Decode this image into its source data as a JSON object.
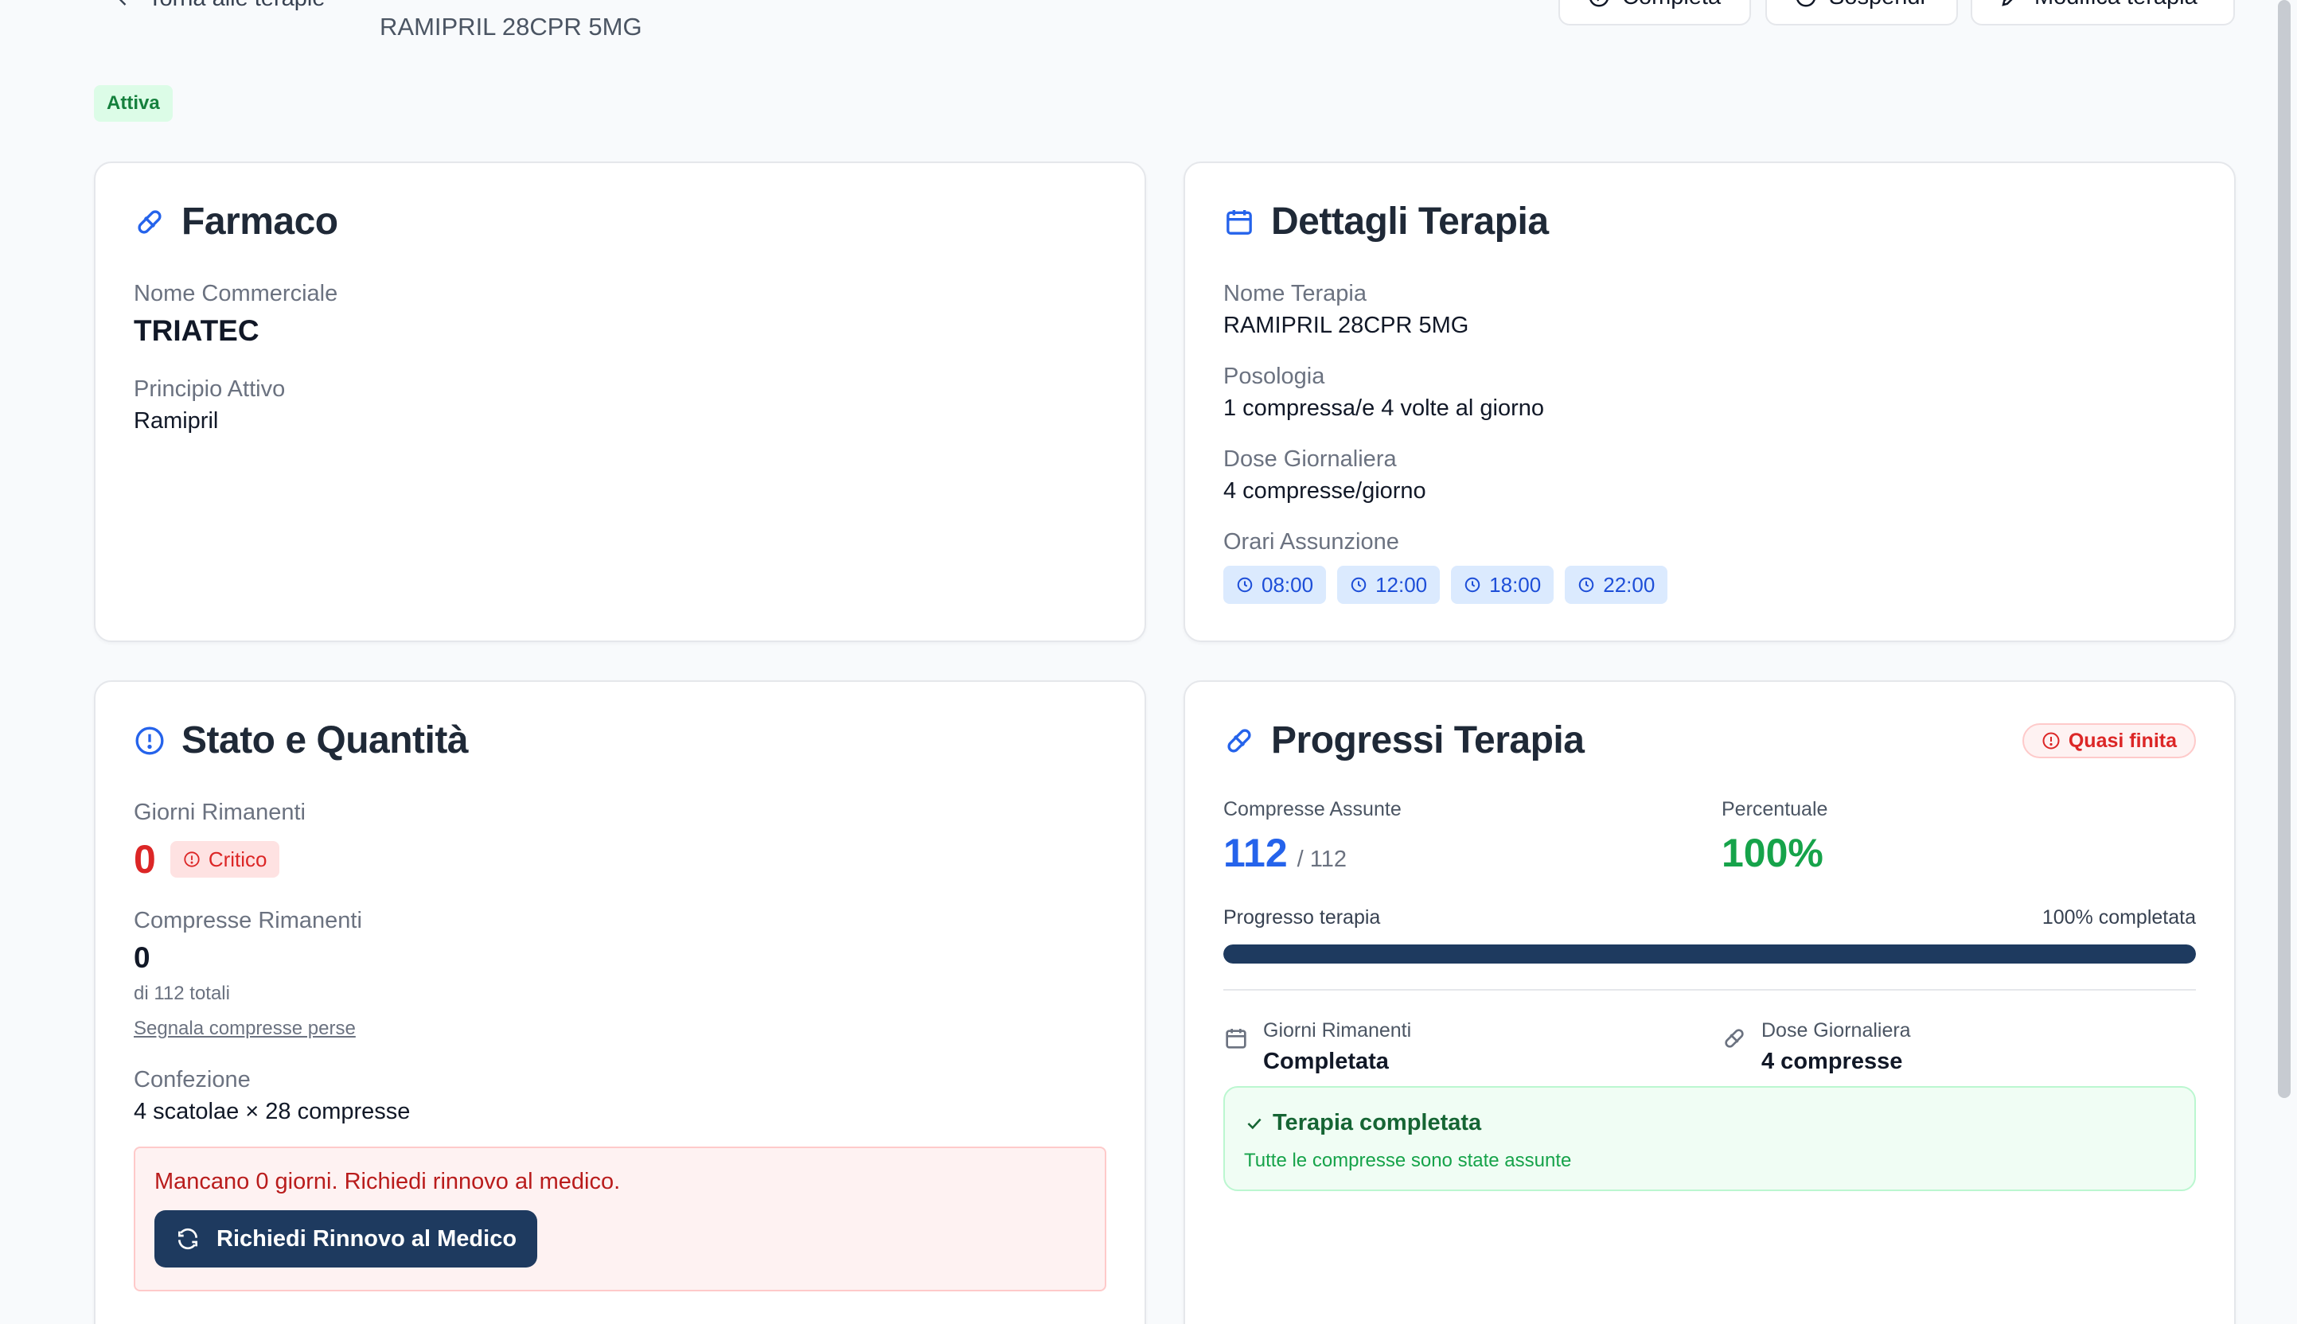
{
  "header": {
    "back_label": "Torna alle terapie",
    "subtitle": "RAMIPRIL 28CPR 5MG",
    "buttons": {
      "complete": "Completa",
      "suspend": "Sospendi",
      "edit": "Modifica terapia"
    }
  },
  "status": {
    "label": "Attiva",
    "color": "#15803d"
  },
  "farmaco": {
    "title": "Farmaco",
    "icon": "pill-icon",
    "commercial_name_label": "Nome Commerciale",
    "commercial_name": "TRIATEC",
    "active_ingredient_label": "Principio Attivo",
    "active_ingredient": "Ramipril"
  },
  "dettagli": {
    "title": "Dettagli Terapia",
    "icon": "calendar-icon",
    "therapy_name_label": "Nome Terapia",
    "therapy_name": "RAMIPRIL 28CPR 5MG",
    "posology_label": "Posologia",
    "posology": "1 compressa/e 4 volte al giorno",
    "daily_dose_label": "Dose Giornaliera",
    "daily_dose": "4 compresse/giorno",
    "times_label": "Orari Assunzione",
    "times": [
      "08:00",
      "12:00",
      "18:00",
      "22:00"
    ]
  },
  "stato": {
    "title": "Stato e Quantità",
    "icon": "alert-circle-icon",
    "days_left_label": "Giorni Rimanenti",
    "days_left": "0",
    "critical_label": "Critico",
    "pills_left_label": "Compresse Rimanenti",
    "pills_left": "0",
    "pills_total": "di 112 totali",
    "report_lost_link": "Segnala compresse perse",
    "package_label": "Confezione",
    "package": "4 scatolae × 28 compresse",
    "alert_text": "Mancano 0 giorni. Richiedi rinnovo al medico.",
    "renew_button": "Richiedi Rinnovo al Medico"
  },
  "progressi": {
    "title": "Progressi Terapia",
    "icon": "pill-icon",
    "badge": "Quasi finita",
    "taken_label": "Compresse Assunte",
    "taken": "112",
    "taken_total": "/ 112",
    "percent_label": "Percentuale",
    "percent": "100%",
    "progress_label": "Progresso terapia",
    "progress_status": "100% completata",
    "progress_value": 1.0,
    "days_left_label": "Giorni Rimanenti",
    "days_left": "Completata",
    "daily_dose_label": "Dose Giornaliera",
    "daily_dose": "4 compresse",
    "done_title": "Terapia completata",
    "done_text": "Tutte le compresse sono state assunte"
  },
  "colors": {
    "primary": "#1e3a5f",
    "accent_blue": "#2563eb",
    "success": "#16a34a",
    "danger": "#dc2626"
  }
}
